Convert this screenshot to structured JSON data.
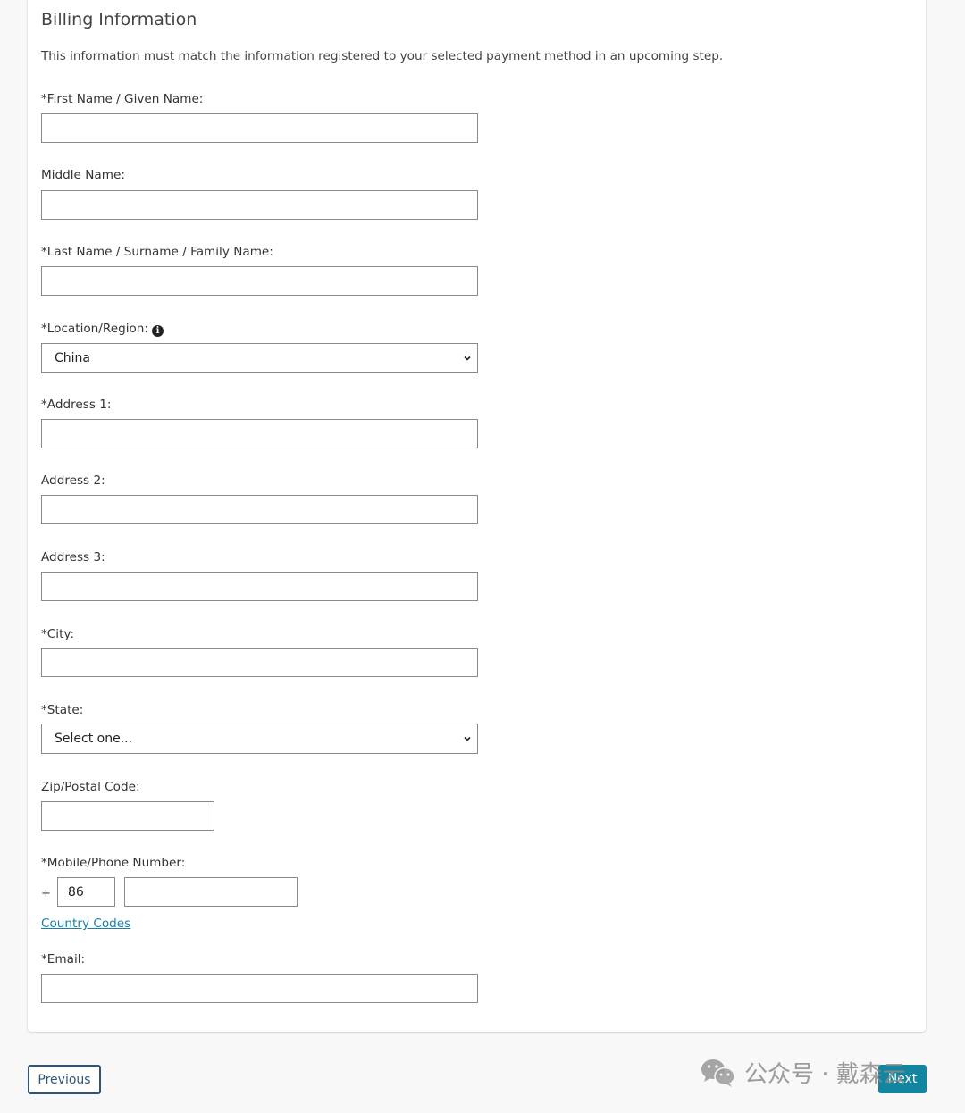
{
  "section": {
    "title": "Billing Information",
    "subtitle": "This information must match the information registered to your selected payment method in an upcoming step."
  },
  "fields": {
    "first_name": {
      "label": "*First Name / Given Name:",
      "value": ""
    },
    "middle_name": {
      "label": "Middle Name:",
      "value": ""
    },
    "last_name": {
      "label": "*Last Name / Surname / Family Name:",
      "value": ""
    },
    "location": {
      "label": "*Location/Region:",
      "selected": "China",
      "info_icon": "info-circle-icon"
    },
    "address1": {
      "label": "*Address 1:",
      "value": ""
    },
    "address2": {
      "label": "Address 2:",
      "value": ""
    },
    "address3": {
      "label": "Address 3:",
      "value": ""
    },
    "city": {
      "label": "*City:",
      "value": ""
    },
    "state": {
      "label": "*State:",
      "selected": "Select one..."
    },
    "zip": {
      "label": "Zip/Postal Code:",
      "value": ""
    },
    "phone": {
      "label": "*Mobile/Phone Number:",
      "prefix": "+",
      "country_code": "86",
      "number": ""
    },
    "country_codes_link": "Country Codes",
    "email": {
      "label": "*Email:",
      "value": ""
    }
  },
  "buttons": {
    "previous": "Previous",
    "next": "Next"
  },
  "watermark": {
    "icon": "wechat-icon",
    "text": "公众号 · 戴森云"
  },
  "colors": {
    "link": "#1a7fa6",
    "next_button": "#13869f",
    "previous_border": "#2f5676"
  }
}
